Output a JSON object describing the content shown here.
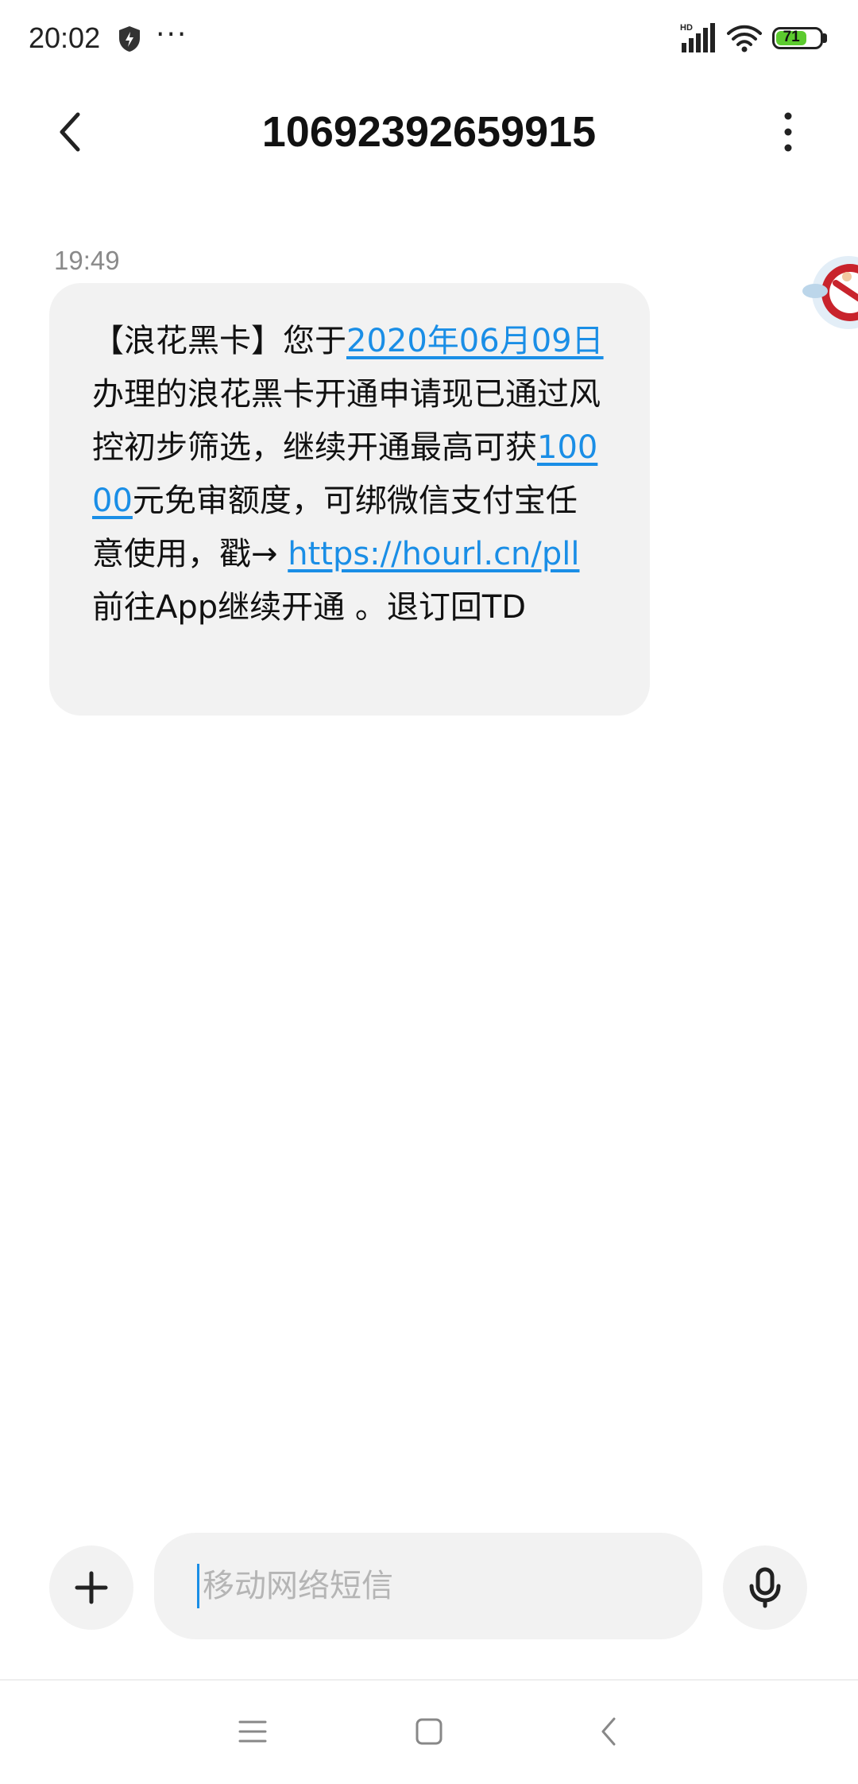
{
  "status_bar": {
    "time": "20:02",
    "overflow": "···",
    "battery_level": "71",
    "network_label": "HD",
    "icons": [
      "shield-icon",
      "signal-icon",
      "wifi-icon",
      "battery-icon"
    ]
  },
  "header": {
    "title": "10692392659915",
    "back_icon": "back-arrow-icon",
    "more_icon": "more-vertical-icon"
  },
  "message": {
    "time": "19:49",
    "segments": [
      {
        "text": "【浪花黑卡】您于",
        "link": false
      },
      {
        "text": "2020年06月09日",
        "link": true
      },
      {
        "text": "办理的浪花黑卡开通申请现已通过风控初步筛选，继续开通最高可获",
        "link": false
      },
      {
        "text": "10000",
        "link": true
      },
      {
        "text": "元免审额度，可绑微信支付宝任意使用，戳→ ",
        "link": false
      },
      {
        "text": "https://hourl.cn/pll",
        "link": true
      },
      {
        "text": " 前往App继续开通 。退订回TD",
        "link": false
      }
    ]
  },
  "composer": {
    "placeholder": "移动网络短信",
    "value": "",
    "add_icon": "plus-icon",
    "mic_icon": "microphone-icon"
  },
  "nav_bar": {
    "icons": [
      "menu-icon",
      "home-icon",
      "back-icon"
    ]
  },
  "colors": {
    "link": "#1a8ee6",
    "bubble": "#f2f2f2",
    "battery": "#5ccb2f",
    "muted": "#8a8a8a"
  }
}
